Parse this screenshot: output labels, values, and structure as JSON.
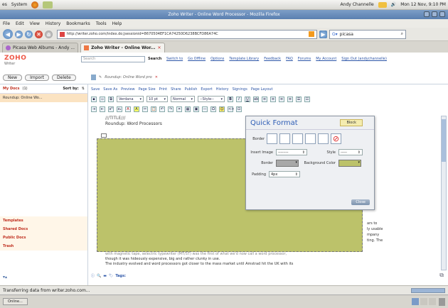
{
  "system_bar": {
    "apps_menu": "es",
    "system_menu": "System",
    "user": "Andy Channelle",
    "datetime": "Mon 12 Nov, 9:10 PM"
  },
  "window": {
    "title": "Zoho Writer - Online Word Processor - Mozilla Firefox"
  },
  "menu": [
    "File",
    "Edit",
    "View",
    "History",
    "Bookmarks",
    "Tools",
    "Help"
  ],
  "nav": {
    "url": "http://writer.zoho.com/index.do;jsessionid=8670504EF1CA74250D6238BCFD86A74C",
    "search_value": "picasa"
  },
  "tabs": [
    {
      "label": "Picasa Web Albums - Andy ..."
    },
    {
      "label": "Zoho Writer - Online Wor..."
    }
  ],
  "zoho": {
    "logo": "ZOHO",
    "logo_sub": "Writer",
    "search_placeholder": "Search",
    "search_btn": "Search",
    "top_links": [
      "Switch to",
      "Go Offline",
      "Options",
      "Template Library",
      "Feedback",
      "FAQ",
      "Forums",
      "My Account",
      "Sign Out (andychannelle)"
    ],
    "buttons": [
      "New",
      "Import",
      "Delete"
    ],
    "doc_path": "Roundup: Online Word pro",
    "toolbar1": [
      "Save",
      "Save As",
      "Preview",
      "Page Size",
      "Print",
      "Share",
      "Publish",
      "Export",
      "History",
      "Signings",
      "Page Layout"
    ],
    "font": "Verdana",
    "size": "10 pt",
    "format": "Normal",
    "style": "--Style--"
  },
  "sidebar": {
    "header": "My Docs",
    "count": "(1)",
    "sort": "Sort by:",
    "doc": "Roundup: Online Wo...",
    "sections": [
      "Templates",
      "Shared Docs",
      "Public Docs",
      "Trash"
    ]
  },
  "editor": {
    "title_field": "///TITLE///",
    "heading": "Roundup: Word Processors",
    "frag": [
      "ars to",
      "ly usable",
      "mpany",
      "ting. The"
    ],
    "body_lines": [
      "with magnetic tape, selectric typewriter (MT/ST) was the first of what we'd now call a word processor,",
      "though it was hideously expensive, big and rather clunky in use.",
      "The industry evolved and word processors got closer to the mass market until Amstrad hit the UK with its"
    ],
    "tags_label": "Tags:"
  },
  "quick_format": {
    "title": "Quick Format",
    "block_btn": "Block",
    "border_label": "Border",
    "insert_image_label": "Insert Image",
    "insert_image_value": "--------",
    "style_label": "Style",
    "style_value": "-----",
    "border2_label": "Border",
    "bg_label": "Background Color",
    "padding_label": "Padding",
    "padding_value": "4px",
    "close": "Close"
  },
  "status": "Transferring data from writer.zoho.com...",
  "taskbar": {
    "item": "Online..."
  },
  "colors": {
    "olive": "#bcc26a",
    "titlebar": "#5a7fb0",
    "link": "#2d56a8"
  }
}
